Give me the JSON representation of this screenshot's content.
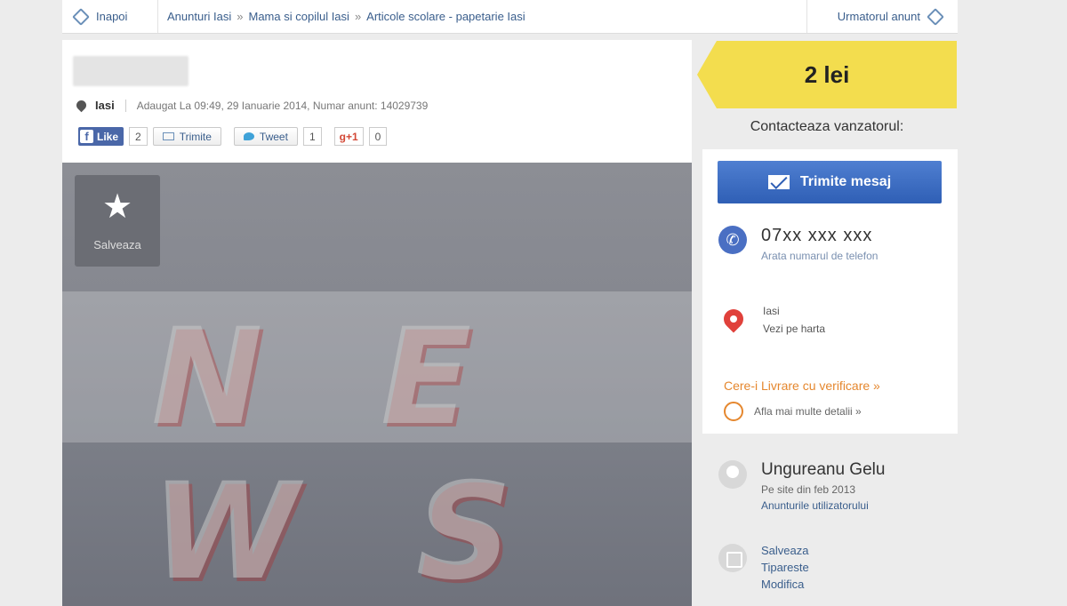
{
  "nav": {
    "back_label": "Inapoi",
    "breadcrumbs": [
      "Anunturi Iasi",
      "Mama si copilul Iasi",
      "Articole scolare - papetarie Iasi"
    ],
    "separator": "»",
    "next_label": "Urmatorul anunt"
  },
  "listing": {
    "city": "Iasi",
    "meta": "Adaugat La 09:49, 29 Ianuarie 2014, Numar anunt: 14029739",
    "save_label": "Salveaza"
  },
  "social": {
    "like_label": "Like",
    "like_count": "2",
    "send_label": "Trimite",
    "tweet_label": "Tweet",
    "tweet_count": "1",
    "gplus_label": "g+1",
    "gplus_count": "0"
  },
  "watermark": "N E W S",
  "sidebar": {
    "price": "2 lei",
    "contact_title": "Contacteaza vanzatorul:",
    "message_button": "Trimite mesaj",
    "phone": "07xx xxx xxx",
    "show_phone": "Arata numarul de telefon",
    "location_city": "Iasi",
    "map_link": "Vezi pe harta",
    "delivery_title": "Cere-i Livrare cu verificare »",
    "delivery_details": "Afla mai multe detalii »"
  },
  "seller": {
    "name": "Ungureanu Gelu",
    "since": "Pe site din feb 2013",
    "ads_link": "Anunturile utilizatorului"
  },
  "actions": [
    "Salveaza",
    "Tipareste",
    "Modifica"
  ],
  "colors": {
    "price_tag": "#f3dd4e",
    "message_button": "#2f5fb5",
    "link": "#3a5e8c",
    "delivery": "#e5872e",
    "map_pin": "#e0413b"
  }
}
